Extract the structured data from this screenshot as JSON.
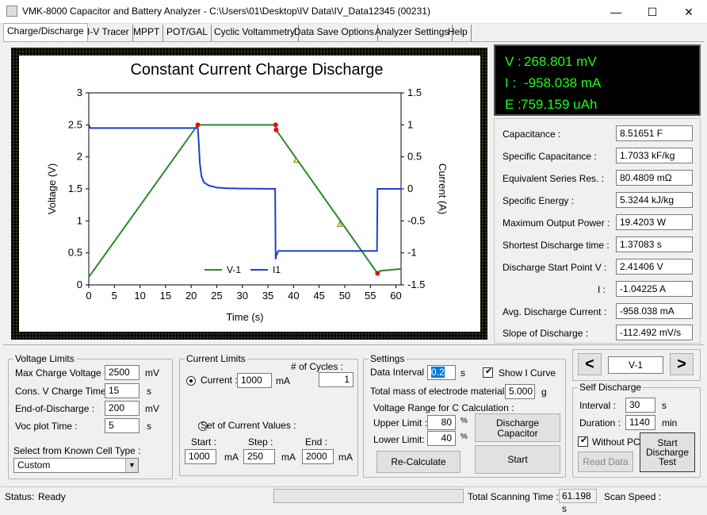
{
  "window": {
    "title": "VMK-8000 Capacitor and Battery Analyzer - C:\\Users\\01\\Desktop\\IV Data\\IV_Data12345 (00231)",
    "minimize": "—",
    "maximize": "☐",
    "close": "✕"
  },
  "tabs": [
    "Charge/Discharge",
    "I-V Tracer",
    "MPPT",
    "POT/GAL",
    "Cyclic Voltammetry",
    "Data Save Options",
    "Analyzer Settings",
    "Help"
  ],
  "chart_data": {
    "type": "line",
    "title": "Constant Current Charge Discharge",
    "xlabel": "Time (s)",
    "ylabel": "Voltage (V)",
    "y2label": "Current (A)",
    "xlim": [
      0,
      61
    ],
    "ylim": [
      0,
      3
    ],
    "y2lim": [
      -1.5,
      1.5
    ],
    "xticks": [
      "0",
      "5",
      "10",
      "15",
      "20",
      "25",
      "30",
      "35",
      "40",
      "45",
      "50",
      "55",
      "60"
    ],
    "yticks": [
      "0",
      "0.5",
      "1",
      "1.5",
      "2",
      "2.5",
      "3"
    ],
    "y2ticks": [
      "-1.5",
      "-1",
      "-0.5",
      "0",
      "0.5",
      "1",
      "1.5"
    ],
    "legend_position": "bottom-center",
    "series": [
      {
        "name": "V-1",
        "color": "#2a8a2a",
        "axis": "left",
        "x": [
          0,
          21.3,
          36.5,
          36.6,
          56.4,
          57,
          61
        ],
        "y": [
          0.12,
          2.5,
          2.5,
          2.42,
          0.18,
          0.22,
          0.25
        ]
      },
      {
        "name": "I1",
        "color": "#1f3fd0",
        "axis": "right",
        "x": [
          0,
          0.3,
          21.3,
          21.5,
          21.7,
          22,
          22.5,
          23.5,
          25,
          27,
          30,
          36.4,
          36.5,
          36.6,
          37,
          56.3,
          56.4,
          56.5,
          61
        ],
        "y": [
          1,
          0.95,
          0.95,
          0.7,
          0.4,
          0.2,
          0.1,
          0.05,
          0.02,
          0.01,
          0.005,
          0,
          -1.1,
          -1.05,
          -0.97,
          -0.97,
          0,
          0,
          0
        ]
      }
    ],
    "markers": [
      {
        "x": 21.3,
        "y": 2.5,
        "color": "red"
      },
      {
        "x": 36.5,
        "y": 2.5,
        "color": "red"
      },
      {
        "x": 36.6,
        "y": 2.42,
        "color": "red"
      },
      {
        "x": 56.4,
        "y": 0.18,
        "color": "red"
      },
      {
        "x": 40.5,
        "y": 1.95,
        "color": "yellow"
      },
      {
        "x": 49,
        "y": 0.95,
        "color": "yellow"
      }
    ]
  },
  "readout": {
    "v_label": "V :",
    "v_value": "268.801 mV",
    "i_label": "I :",
    "i_value": "-958.038 mA",
    "e_label": "E :",
    "e_value": "759.159 uAh"
  },
  "stats": [
    {
      "label": "Capacitance :",
      "value": "8.51651 F"
    },
    {
      "label": "Specific Capacitance :",
      "value": "1.7033 kF/kg"
    },
    {
      "label": "Equivalent Series Res. :",
      "value": "80.4809 mΩ"
    },
    {
      "label": "Specific Energy :",
      "value": "5.3244 kJ/kg"
    },
    {
      "label": "Maximum Output Power :",
      "value": "19.4203 W"
    },
    {
      "label": "Shortest Discharge time :",
      "value": "1.37083 s"
    },
    {
      "label": "Discharge Start Point  V :",
      "value": "2.41406 V"
    },
    {
      "label": "I :",
      "value": "-1.04225 A"
    },
    {
      "label": "Avg. Discharge Current :",
      "value": "-958.038 mA"
    },
    {
      "label": "Slope of Discharge :",
      "value": "-112.492 mV/s"
    }
  ],
  "voltage_limits": {
    "title": "Voltage Limits",
    "max_charge_label": "Max Charge Voltage :",
    "max_charge": "2500",
    "max_charge_unit": "mV",
    "cons_v_label": "Cons. V Charge Time :",
    "cons_v": "15",
    "cons_v_unit": "s",
    "eod_label": "End-of-Discharge :",
    "eod": "200",
    "eod_unit": "mV",
    "voc_label": "Voc plot Time :",
    "voc": "5",
    "voc_unit": "s",
    "cell_type_label": "Select from Known Cell Type :",
    "cell_type": "Custom"
  },
  "current_limits": {
    "title": "Current Limits",
    "cycles_label": "# of Cycles :",
    "cycles": "1",
    "current_label": "Current :",
    "current": "1000",
    "current_unit": "mA",
    "set_label": "Set of Current Values :",
    "start_label": "Start :",
    "step_label": "Step :",
    "end_label": "End :",
    "start": "1000",
    "step": "250",
    "end": "2000",
    "unit": "mA"
  },
  "settings": {
    "title": "Settings",
    "interval_label": "Data Interval :",
    "interval": "0.2",
    "interval_unit": "s",
    "show_i_label": "Show I Curve",
    "mass_label": "Total mass of electrode materials :",
    "mass": "5.000",
    "mass_unit": "g",
    "vrange_label": "Voltage Range for C Calculation :",
    "upper_label": "Upper Limit :",
    "upper": "80",
    "lower_label": "Lower Limit:",
    "lower": "40",
    "pct": "%",
    "discharge_btn_1": "Discharge",
    "discharge_btn_2": "Capacitor",
    "recalc_btn": "Re-Calculate",
    "start_btn": "Start"
  },
  "channel": {
    "prev": "<",
    "current": "V-1",
    "next": ">"
  },
  "self_discharge": {
    "title": "Self Discharge",
    "interval_label": "Interval :",
    "interval": "30",
    "interval_unit": "s",
    "duration_label": "Duration :",
    "duration": "1140",
    "duration_unit": "min",
    "without_pc_label": "Without PC",
    "read_btn": "Read Data",
    "start_btn_1": "Start",
    "start_btn_2": "Discharge",
    "start_btn_3": "Test"
  },
  "status": {
    "status_label": "Status:",
    "status_value": "Ready",
    "scan_time_label": "Total Scanning Time :",
    "scan_time": "61.198 s",
    "scan_speed_label": "Scan Speed :"
  }
}
